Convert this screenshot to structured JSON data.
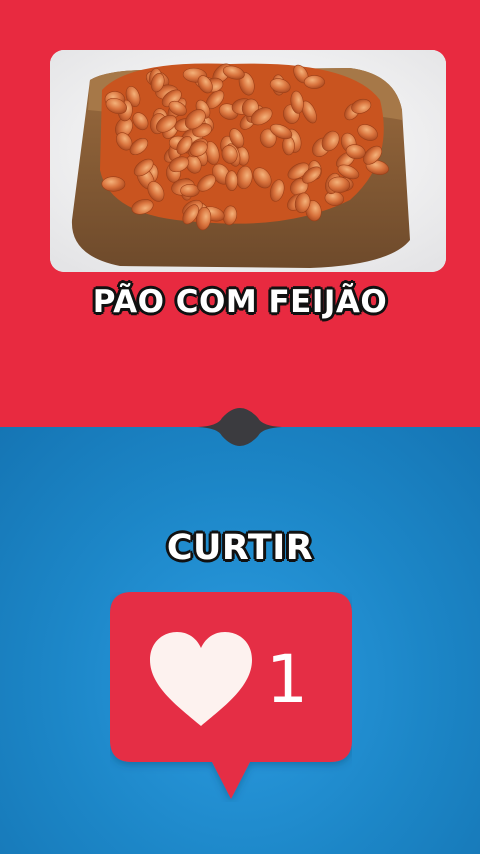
{
  "top_panel": {
    "background": "#e82a40"
  },
  "bottom_panel": {
    "background": "#1e86c8"
  },
  "food_image": {
    "subject": "baked beans on toast"
  },
  "food_caption": "PÃO COM FEIJÃO",
  "action_caption": "CURTIR",
  "like_badge": {
    "count": "1",
    "icon": "heart-icon",
    "color": "#e52d44",
    "heart_color": "#fdf2ef"
  }
}
